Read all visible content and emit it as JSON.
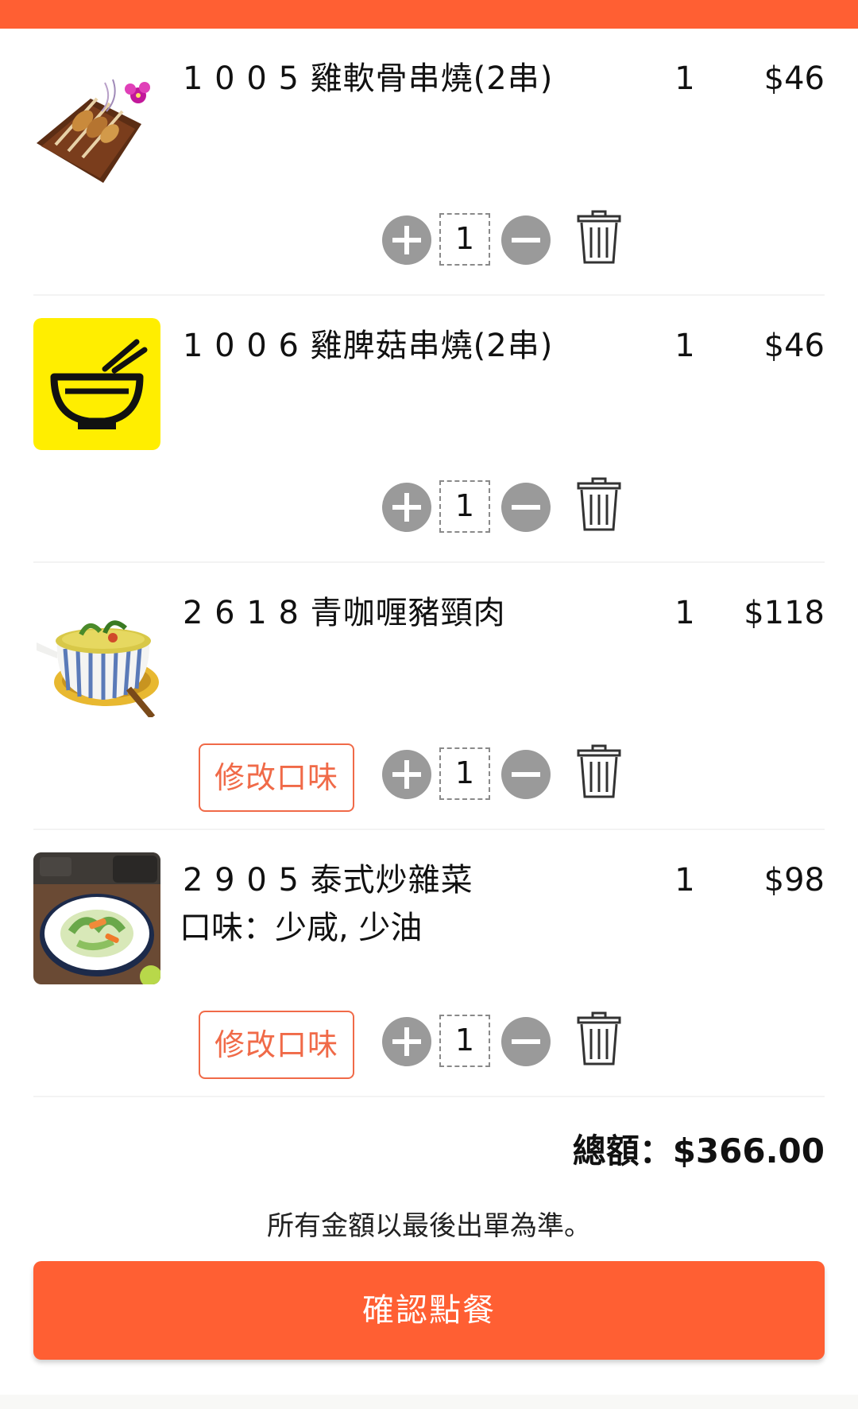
{
  "colors": {
    "accent": "#ff5f33",
    "taste_button": "#f06a48",
    "control_gray": "#9a9a9a",
    "bowl_icon_bg": "#ffee00"
  },
  "cart": {
    "items": [
      {
        "name": "1 0 0 5  雞軟骨串燒(2串)",
        "quantity": "1",
        "price": "$46",
        "stepper_value": "1",
        "image": "grilled-skewer-photo"
      },
      {
        "name": "1 0 0 6  雞脾菇串燒(2串)",
        "quantity": "1",
        "price": "$46",
        "stepper_value": "1",
        "image": "bowl-icon"
      },
      {
        "name": "2 6 1 8  青咖喱豬頸肉",
        "quantity": "1",
        "price": "$118",
        "stepper_value": "1",
        "taste_button": "修改口味",
        "image": "curry-pot-photo"
      },
      {
        "name": "2 9 0 5  泰式炒雜菜",
        "note": "口味：少咸, 少油",
        "quantity": "1",
        "price": "$98",
        "stepper_value": "1",
        "taste_button": "修改口味",
        "image": "stir-fried-vegetables-photo"
      }
    ]
  },
  "summary": {
    "total": "總額：$366.00",
    "disclaimer": "所有金額以最後出單為準。",
    "confirm_label": "確認點餐"
  }
}
